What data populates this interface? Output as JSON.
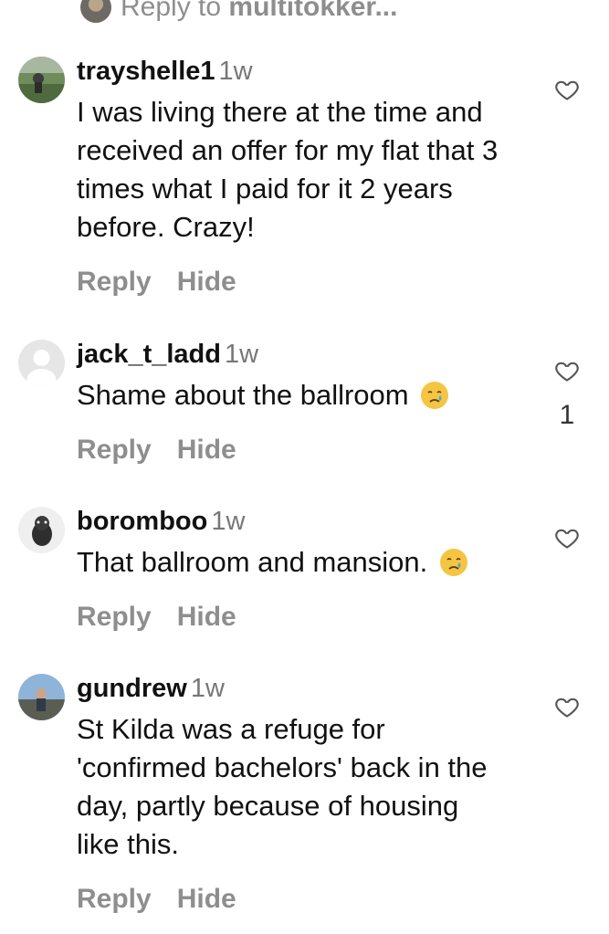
{
  "top_reply": {
    "prefix": "Reply to ",
    "username": "multitokker..."
  },
  "comments": [
    {
      "username": "trayshelle1",
      "time": "1w",
      "text": "I was living there at the time and received an offer for my flat that 3 times what I paid for it 2 years before. Crazy!",
      "reply_label": "Reply",
      "hide_label": "Hide",
      "likes": "",
      "emoji": ""
    },
    {
      "username": "jack_t_ladd",
      "time": "1w",
      "text": "Shame about the ballroom",
      "reply_label": "Reply",
      "hide_label": "Hide",
      "likes": "1",
      "emoji": "crying-face"
    },
    {
      "username": "boromboo",
      "time": "1w",
      "text": "That ballroom and mansion.",
      "reply_label": "Reply",
      "hide_label": "Hide",
      "likes": "",
      "emoji": "crying-face"
    },
    {
      "username": "gundrew",
      "time": "1w",
      "text": "St Kilda was a refuge for 'confirmed bachelors' back in the day, partly because of housing like this.",
      "reply_label": "Reply",
      "hide_label": "Hide",
      "likes": "",
      "emoji": ""
    }
  ],
  "icons": {
    "like": "heart-outline-icon",
    "emoji": "crying-face-emoji"
  },
  "colors": {
    "text": "#111111",
    "muted": "#8e8e8e",
    "emoji": "#f5c542"
  }
}
